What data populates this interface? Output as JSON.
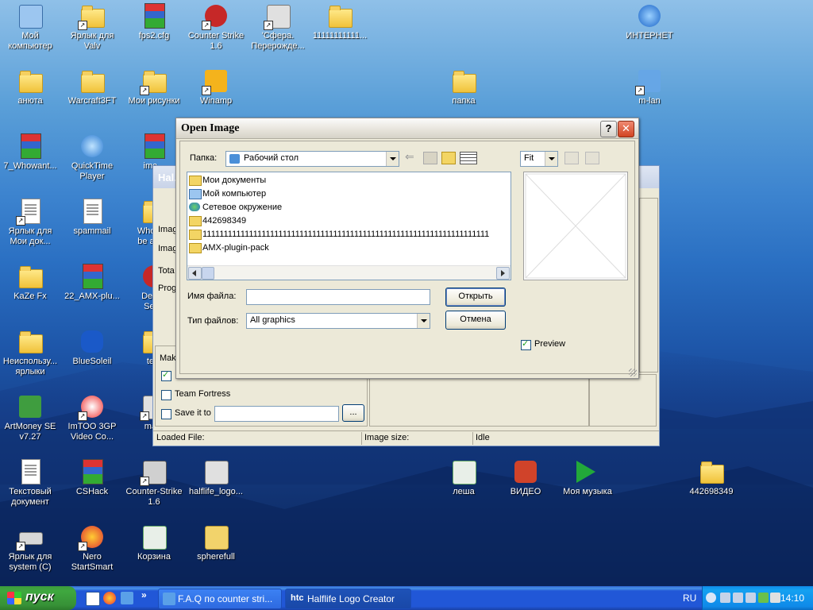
{
  "desktop_icons": [
    {
      "label": "Мой\nкомпьютер",
      "kind": "computer",
      "x": 1
    },
    {
      "label": "Ярлык для\nValv",
      "kind": "folder"
    },
    {
      "label": "fps2.cfg",
      "kind": "rar"
    },
    {
      "label": "Counter Strike\n1.6",
      "kind": "hl"
    },
    {
      "label": "'Сфера.\nПерерожде...",
      "kind": "app"
    },
    {
      "label": "11111111111...",
      "kind": "folder"
    },
    {
      "label": "ИНТЕРНЕТ",
      "kind": "ie"
    },
    {
      "label": "анюта",
      "kind": "folder"
    },
    {
      "label": "Warcraft3FT",
      "kind": "folder"
    },
    {
      "label": "Мои рисунки",
      "kind": "folder"
    },
    {
      "label": "Winamp",
      "kind": "winamp"
    },
    {
      "label": "папка",
      "kind": "folder"
    },
    {
      "label": "m-lan",
      "kind": "net"
    },
    {
      "label": "7_Whowant...",
      "kind": "rar"
    },
    {
      "label": "QuickTime\nPlayer",
      "kind": "qt"
    },
    {
      "label": "ima...",
      "kind": "rar"
    },
    {
      "label": "Ярлык для\nМои док...",
      "kind": "doc"
    },
    {
      "label": "spammail",
      "kind": "doc"
    },
    {
      "label": "Who w...\nbe a C...",
      "kind": "folder"
    },
    {
      "label": "KaZe Fx",
      "kind": "folder"
    },
    {
      "label": "22_AMX-plu...",
      "kind": "rar"
    },
    {
      "label": "Dedi...\nSer...",
      "kind": "hl"
    },
    {
      "label": "Неиспользу...\nярлыки",
      "kind": "folder"
    },
    {
      "label": "BlueSoleil",
      "kind": "bt"
    },
    {
      "label": "te...",
      "kind": "folder"
    },
    {
      "label": "ArtMoney SE\nv7.27",
      "kind": "money"
    },
    {
      "label": "ImTOO 3GP\nVideo Co...",
      "kind": "imtoo"
    },
    {
      "label": "ma...",
      "kind": "app"
    },
    {
      "label": "Текстовый\nдокумент",
      "kind": "doc"
    },
    {
      "label": "CSHack",
      "kind": "rar"
    },
    {
      "label": "Counter-Strike\n1.6",
      "kind": "cs"
    },
    {
      "label": "halflife_logo...",
      "kind": "app"
    },
    {
      "label": "леша",
      "kind": "recycle"
    },
    {
      "label": "ВИДЕО",
      "kind": "video"
    },
    {
      "label": "Моя музыка",
      "kind": "play"
    },
    {
      "label": "442698349",
      "kind": "folder"
    },
    {
      "label": "Ярлык для\nsystem (C)",
      "kind": "drive"
    },
    {
      "label": "Nero\nStartSmart",
      "kind": "nero"
    },
    {
      "label": "Корзина",
      "kind": "recycle"
    },
    {
      "label": "spherefull",
      "kind": "zip"
    }
  ],
  "back_window": {
    "title": "Hal...",
    "labels": {
      "image1": "Imag",
      "image2": "Imag",
      "total": "Tota",
      "prog": "Prog",
      "make": "Mak"
    },
    "checkbox_team_fortress": {
      "label": "Team Fortress",
      "checked": false
    },
    "checkbox_save": {
      "label": "Save it to",
      "checked": false
    },
    "browse_label": "...",
    "status": {
      "loaded": "Loaded File:",
      "size": "Image size:",
      "state": "Idle"
    }
  },
  "dialog": {
    "title": "Open Image",
    "help_label": "?",
    "close_label": "✕",
    "folder_label": "Папка:",
    "folder_value": "Рабочий стол",
    "files": [
      {
        "name": "Мои документы",
        "kind": "docs"
      },
      {
        "name": "Мой компьютер",
        "kind": "computer"
      },
      {
        "name": "Сетевое окружение",
        "kind": "network"
      },
      {
        "name": "442698349",
        "kind": "folder"
      },
      {
        "name": "11111111111111111111111111111111111111111111111111111111111111111111",
        "kind": "folder"
      },
      {
        "name": "AMX-plugin-pack",
        "kind": "folder"
      }
    ],
    "filename_label": "Имя файла:",
    "filename_value": "",
    "filetype_label": "Тип файлов:",
    "filetype_value": "All graphics",
    "open_label": "Открыть",
    "cancel_label": "Отмена",
    "zoom_value": "Fit",
    "preview_label": "Preview",
    "preview_checked": true
  },
  "taskbar": {
    "start_label": "пуск",
    "tasks": [
      {
        "label": "F.A.Q по counter stri...",
        "active": false
      },
      {
        "label": "Halflife Logo Creator",
        "icon_text": "htc",
        "active": true
      }
    ],
    "language": "RU",
    "clock": "14:10"
  },
  "colors": {
    "accent": "#2157d7",
    "start": "#3c9a3c",
    "close": "#d24422"
  }
}
